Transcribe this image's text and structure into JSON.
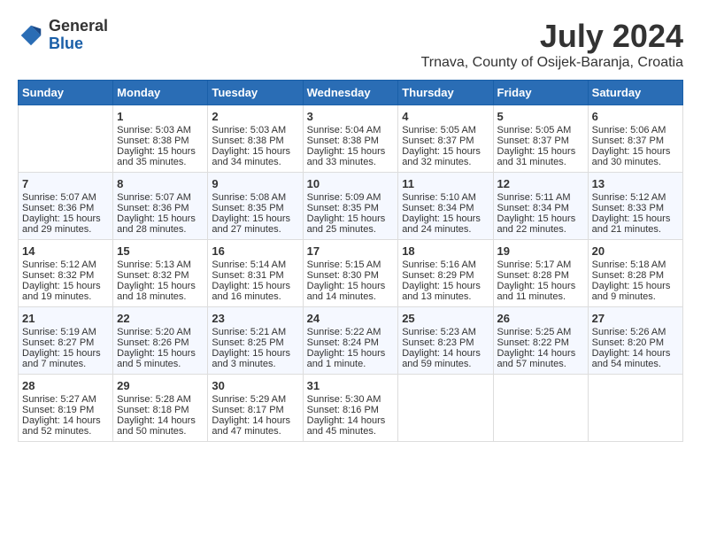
{
  "logo": {
    "general": "General",
    "blue": "Blue"
  },
  "title": {
    "month_year": "July 2024",
    "location": "Trnava, County of Osijek-Baranja, Croatia"
  },
  "days_of_week": [
    "Sunday",
    "Monday",
    "Tuesday",
    "Wednesday",
    "Thursday",
    "Friday",
    "Saturday"
  ],
  "weeks": [
    [
      {
        "day": "",
        "sunrise": "",
        "sunset": "",
        "daylight": ""
      },
      {
        "day": "1",
        "sunrise": "Sunrise: 5:03 AM",
        "sunset": "Sunset: 8:38 PM",
        "daylight": "Daylight: 15 hours and 35 minutes."
      },
      {
        "day": "2",
        "sunrise": "Sunrise: 5:03 AM",
        "sunset": "Sunset: 8:38 PM",
        "daylight": "Daylight: 15 hours and 34 minutes."
      },
      {
        "day": "3",
        "sunrise": "Sunrise: 5:04 AM",
        "sunset": "Sunset: 8:38 PM",
        "daylight": "Daylight: 15 hours and 33 minutes."
      },
      {
        "day": "4",
        "sunrise": "Sunrise: 5:05 AM",
        "sunset": "Sunset: 8:37 PM",
        "daylight": "Daylight: 15 hours and 32 minutes."
      },
      {
        "day": "5",
        "sunrise": "Sunrise: 5:05 AM",
        "sunset": "Sunset: 8:37 PM",
        "daylight": "Daylight: 15 hours and 31 minutes."
      },
      {
        "day": "6",
        "sunrise": "Sunrise: 5:06 AM",
        "sunset": "Sunset: 8:37 PM",
        "daylight": "Daylight: 15 hours and 30 minutes."
      }
    ],
    [
      {
        "day": "7",
        "sunrise": "Sunrise: 5:07 AM",
        "sunset": "Sunset: 8:36 PM",
        "daylight": "Daylight: 15 hours and 29 minutes."
      },
      {
        "day": "8",
        "sunrise": "Sunrise: 5:07 AM",
        "sunset": "Sunset: 8:36 PM",
        "daylight": "Daylight: 15 hours and 28 minutes."
      },
      {
        "day": "9",
        "sunrise": "Sunrise: 5:08 AM",
        "sunset": "Sunset: 8:35 PM",
        "daylight": "Daylight: 15 hours and 27 minutes."
      },
      {
        "day": "10",
        "sunrise": "Sunrise: 5:09 AM",
        "sunset": "Sunset: 8:35 PM",
        "daylight": "Daylight: 15 hours and 25 minutes."
      },
      {
        "day": "11",
        "sunrise": "Sunrise: 5:10 AM",
        "sunset": "Sunset: 8:34 PM",
        "daylight": "Daylight: 15 hours and 24 minutes."
      },
      {
        "day": "12",
        "sunrise": "Sunrise: 5:11 AM",
        "sunset": "Sunset: 8:34 PM",
        "daylight": "Daylight: 15 hours and 22 minutes."
      },
      {
        "day": "13",
        "sunrise": "Sunrise: 5:12 AM",
        "sunset": "Sunset: 8:33 PM",
        "daylight": "Daylight: 15 hours and 21 minutes."
      }
    ],
    [
      {
        "day": "14",
        "sunrise": "Sunrise: 5:12 AM",
        "sunset": "Sunset: 8:32 PM",
        "daylight": "Daylight: 15 hours and 19 minutes."
      },
      {
        "day": "15",
        "sunrise": "Sunrise: 5:13 AM",
        "sunset": "Sunset: 8:32 PM",
        "daylight": "Daylight: 15 hours and 18 minutes."
      },
      {
        "day": "16",
        "sunrise": "Sunrise: 5:14 AM",
        "sunset": "Sunset: 8:31 PM",
        "daylight": "Daylight: 15 hours and 16 minutes."
      },
      {
        "day": "17",
        "sunrise": "Sunrise: 5:15 AM",
        "sunset": "Sunset: 8:30 PM",
        "daylight": "Daylight: 15 hours and 14 minutes."
      },
      {
        "day": "18",
        "sunrise": "Sunrise: 5:16 AM",
        "sunset": "Sunset: 8:29 PM",
        "daylight": "Daylight: 15 hours and 13 minutes."
      },
      {
        "day": "19",
        "sunrise": "Sunrise: 5:17 AM",
        "sunset": "Sunset: 8:28 PM",
        "daylight": "Daylight: 15 hours and 11 minutes."
      },
      {
        "day": "20",
        "sunrise": "Sunrise: 5:18 AM",
        "sunset": "Sunset: 8:28 PM",
        "daylight": "Daylight: 15 hours and 9 minutes."
      }
    ],
    [
      {
        "day": "21",
        "sunrise": "Sunrise: 5:19 AM",
        "sunset": "Sunset: 8:27 PM",
        "daylight": "Daylight: 15 hours and 7 minutes."
      },
      {
        "day": "22",
        "sunrise": "Sunrise: 5:20 AM",
        "sunset": "Sunset: 8:26 PM",
        "daylight": "Daylight: 15 hours and 5 minutes."
      },
      {
        "day": "23",
        "sunrise": "Sunrise: 5:21 AM",
        "sunset": "Sunset: 8:25 PM",
        "daylight": "Daylight: 15 hours and 3 minutes."
      },
      {
        "day": "24",
        "sunrise": "Sunrise: 5:22 AM",
        "sunset": "Sunset: 8:24 PM",
        "daylight": "Daylight: 15 hours and 1 minute."
      },
      {
        "day": "25",
        "sunrise": "Sunrise: 5:23 AM",
        "sunset": "Sunset: 8:23 PM",
        "daylight": "Daylight: 14 hours and 59 minutes."
      },
      {
        "day": "26",
        "sunrise": "Sunrise: 5:25 AM",
        "sunset": "Sunset: 8:22 PM",
        "daylight": "Daylight: 14 hours and 57 minutes."
      },
      {
        "day": "27",
        "sunrise": "Sunrise: 5:26 AM",
        "sunset": "Sunset: 8:20 PM",
        "daylight": "Daylight: 14 hours and 54 minutes."
      }
    ],
    [
      {
        "day": "28",
        "sunrise": "Sunrise: 5:27 AM",
        "sunset": "Sunset: 8:19 PM",
        "daylight": "Daylight: 14 hours and 52 minutes."
      },
      {
        "day": "29",
        "sunrise": "Sunrise: 5:28 AM",
        "sunset": "Sunset: 8:18 PM",
        "daylight": "Daylight: 14 hours and 50 minutes."
      },
      {
        "day": "30",
        "sunrise": "Sunrise: 5:29 AM",
        "sunset": "Sunset: 8:17 PM",
        "daylight": "Daylight: 14 hours and 47 minutes."
      },
      {
        "day": "31",
        "sunrise": "Sunrise: 5:30 AM",
        "sunset": "Sunset: 8:16 PM",
        "daylight": "Daylight: 14 hours and 45 minutes."
      },
      {
        "day": "",
        "sunrise": "",
        "sunset": "",
        "daylight": ""
      },
      {
        "day": "",
        "sunrise": "",
        "sunset": "",
        "daylight": ""
      },
      {
        "day": "",
        "sunrise": "",
        "sunset": "",
        "daylight": ""
      }
    ]
  ]
}
